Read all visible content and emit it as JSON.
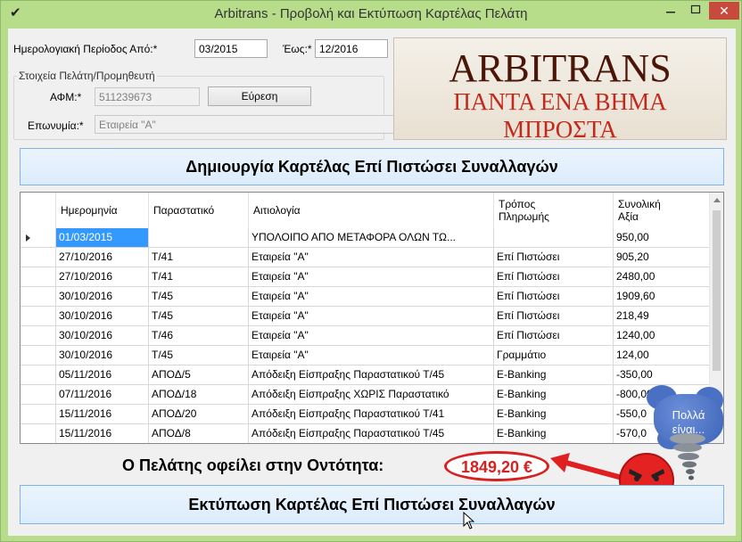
{
  "window": {
    "title": "Arbitrans - Προβολή και Εκτύπωση Καρτέλας Πελάτη",
    "app_icon": "✔",
    "controls": {
      "minimize": "",
      "maximize": "",
      "close": "✕"
    }
  },
  "period": {
    "from_label": "Ημερολογιακή Περίοδος Από:*",
    "from_value": "03/2015",
    "to_label": "Έως:*",
    "to_value": "12/2016"
  },
  "customer_group": {
    "title": "Στοιχεία Πελάτη/Προμηθευτή",
    "afm_label": "ΑΦΜ:*",
    "afm_value": "511239673",
    "search_button": "Εύρεση",
    "name_label": "Επωνυμία:*",
    "name_value": "Εταιρεία \"Α\""
  },
  "logo": {
    "main": "ARBITRANS",
    "sub": "ΠΑΝΤΑ ΕΝΑ ΒΗΜΑ ΜΠΡΟΣΤΑ"
  },
  "create_button": "Δημιουργία Καρτέλας Επί Πιστώσει Συναλλαγών",
  "grid": {
    "columns": [
      {
        "label": "Ημερομηνία"
      },
      {
        "label": "Παραστατικό"
      },
      {
        "label": "Αιτιολογία"
      },
      {
        "label": "Τρόπος\nΠληρωμής"
      },
      {
        "label": "Συνολική\nΑξία"
      }
    ],
    "rows": [
      [
        "01/03/2015",
        "",
        "ΥΠΟΛΟΙΠΟ ΑΠΟ ΜΕΤΑΦΟΡΑ ΟΛΩΝ ΤΩ...",
        "",
        "950,00"
      ],
      [
        "27/10/2016",
        "Τ/41",
        "Εταιρεία \"Α\"",
        "Επί Πιστώσει",
        "905,20"
      ],
      [
        "27/10/2016",
        "Τ/41",
        "Εταιρεία \"Α\"",
        "Επί Πιστώσει",
        "2480,00"
      ],
      [
        "30/10/2016",
        "Τ/45",
        "Εταιρεία \"Α\"",
        "Επί Πιστώσει",
        "1909,60"
      ],
      [
        "30/10/2016",
        "Τ/45",
        "Εταιρεία \"Α\"",
        "Επί Πιστώσει",
        "218,49"
      ],
      [
        "30/10/2016",
        "Τ/46",
        "Εταιρεία \"Α\"",
        "Επί Πιστώσει",
        "1240,00"
      ],
      [
        "30/10/2016",
        "Τ/45",
        "Εταιρεία \"Α\"",
        "Γραμμάτιο",
        "124,00"
      ],
      [
        "05/11/2016",
        "ΑΠΟΔ/5",
        "Απόδειξη Είσπραξης Παραστατικού Τ/45",
        "E-Banking",
        "-350,00"
      ],
      [
        "07/11/2016",
        "ΑΠΟΔ/18",
        "Απόδειξη Είσπραξης ΧΩΡΙΣ Παραστατικό",
        "E-Banking",
        "-800,00"
      ],
      [
        "15/11/2016",
        "ΑΠΟΔ/20",
        "Απόδειξη Είσπραξης Παραστατικού Τ/41",
        "E-Banking",
        "-550,0"
      ],
      [
        "15/11/2016",
        "ΑΠΟΔ/8",
        "Απόδειξη Είσπραξης Παραστατικού Τ/45",
        "E-Banking",
        "-570,0"
      ]
    ],
    "selected_row": 0,
    "selected_col": 0
  },
  "balance": {
    "label": "Ο Πελάτης οφείλει στην Οντότητα:",
    "amount": "1849,20 €",
    "color": "#d92020"
  },
  "bubble_text": "Πολλά\nείναι...",
  "print_button": "Εκτύπωση Καρτέλας Επί Πιστώσει Συναλλαγών",
  "colors": {
    "window_frame": "#b7dd8b",
    "close_button": "#c74b3d",
    "selection": "#3399ff",
    "big_button_border": "#7eb4ea",
    "logo_main": "#4a1608",
    "logo_sub": "#c4281a"
  }
}
